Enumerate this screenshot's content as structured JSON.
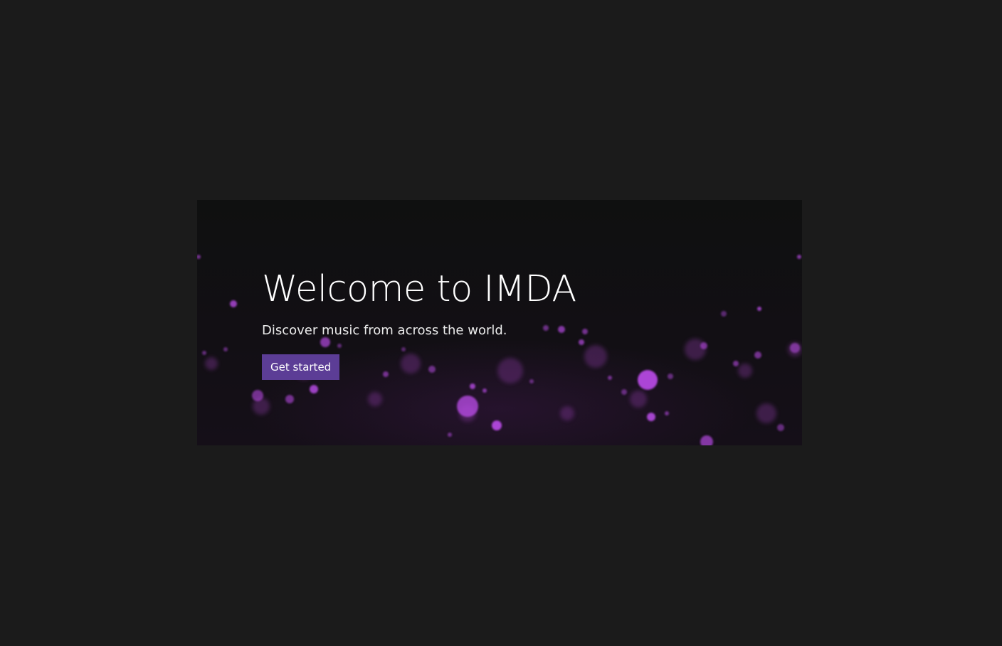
{
  "hero": {
    "title": "Welcome to IMDA",
    "subtitle": "Discover music from across the world.",
    "cta_label": "Get started",
    "accent_color": "#5c3d96",
    "particle_color": "#b44ae0",
    "background_color": "#1b1b1b"
  }
}
